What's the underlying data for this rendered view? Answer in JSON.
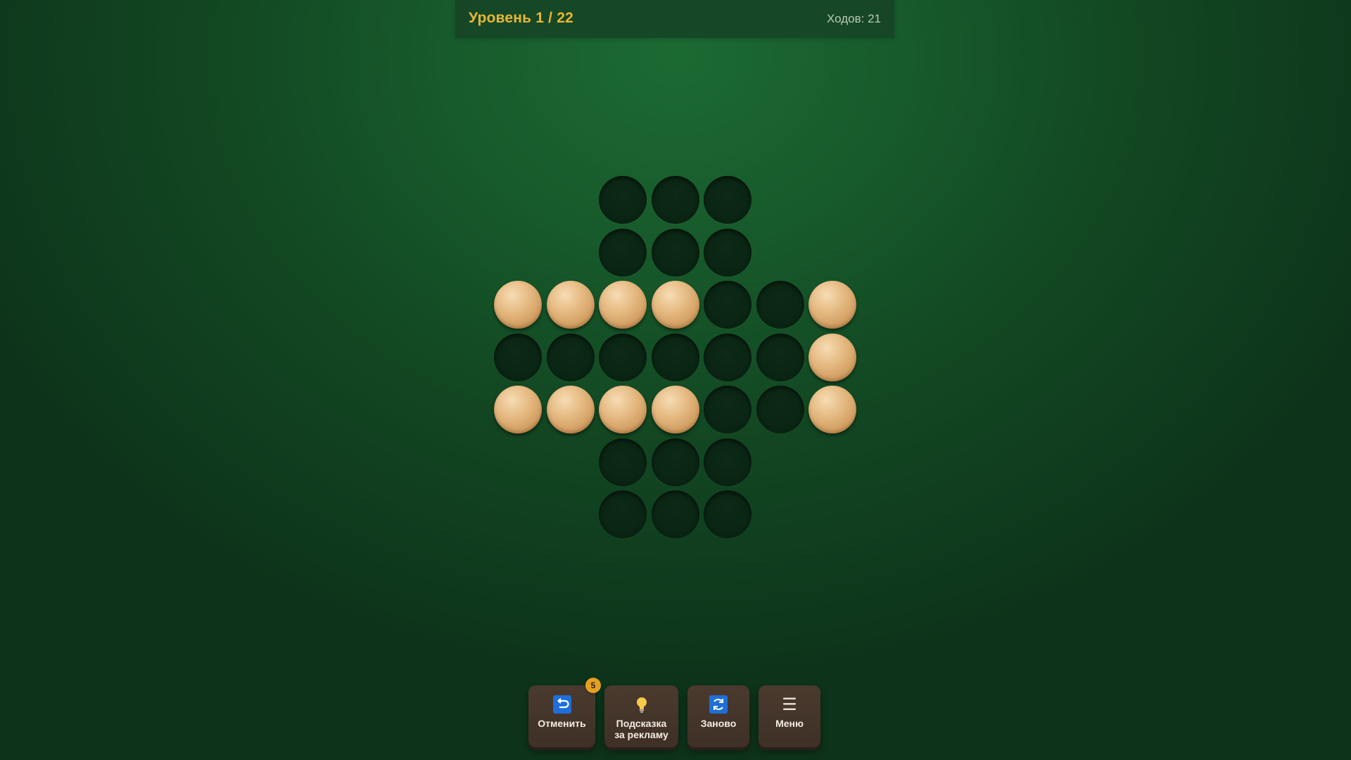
{
  "header": {
    "level_label": "Уровень 1 / 22",
    "moves_label": "Ходов: 21"
  },
  "board": {
    "rows": [
      [
        null,
        null,
        0,
        0,
        0,
        null,
        null
      ],
      [
        null,
        null,
        0,
        0,
        0,
        null,
        null
      ],
      [
        1,
        1,
        1,
        1,
        0,
        0,
        1
      ],
      [
        0,
        0,
        0,
        0,
        0,
        0,
        1
      ],
      [
        1,
        1,
        1,
        1,
        0,
        0,
        1
      ],
      [
        null,
        null,
        0,
        0,
        0,
        null,
        null
      ],
      [
        null,
        null,
        0,
        0,
        0,
        null,
        null
      ]
    ]
  },
  "toolbar": {
    "undo_label": "Отменить",
    "undo_badge": "5",
    "hint_label_line1": "Подсказка",
    "hint_label_line2": "за рекламу",
    "restart_label": "Заново",
    "menu_label": "Меню",
    "undo_icon": "undo-icon",
    "hint_icon": "lightbulb-icon",
    "restart_icon": "refresh-icon",
    "menu_icon": "hamburger-icon"
  },
  "colors": {
    "accent": "#e7b833",
    "peg": "#e0b07a",
    "hole": "#0a2413",
    "button": "#4a3a2e",
    "badge": "#e4a020",
    "icon_blue": "#1e6fd9"
  }
}
